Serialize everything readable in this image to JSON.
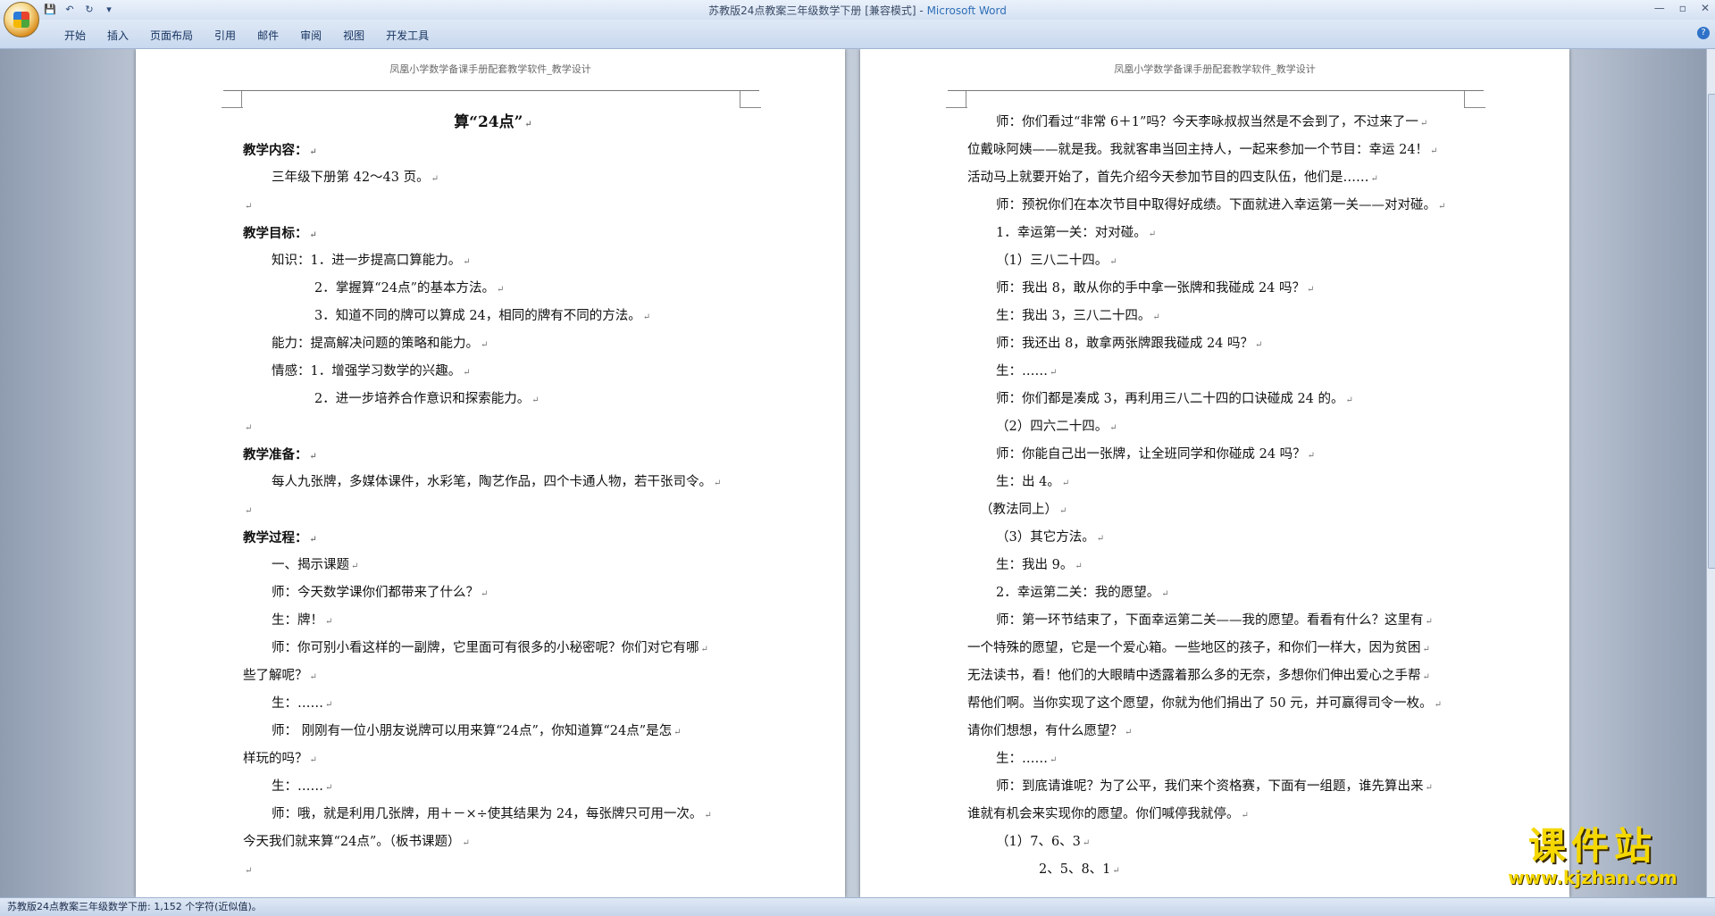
{
  "window": {
    "doc_title": "苏教版24点教案三年级数学下册 [兼容模式] - ",
    "app_name": "Microsoft Word",
    "controls": [
      "—",
      "▫",
      "✕"
    ]
  },
  "qat": {
    "save": "💾",
    "undo": "↶",
    "redo": "↻",
    "more": "▾"
  },
  "ribbon": {
    "tabs": [
      "开始",
      "插入",
      "页面布局",
      "引用",
      "邮件",
      "审阅",
      "视图",
      "开发工具"
    ],
    "help": "?"
  },
  "header_text": "凤凰小学数学备课手册配套教学软件_教学设计",
  "para_mark": "↵",
  "left_page": {
    "lines": [
      {
        "cls": "title",
        "text": "算“24点”"
      },
      {
        "cls": "heading",
        "text": "教学内容："
      },
      {
        "cls": "ind1",
        "text": "三年级下册第 42～43 页。"
      },
      {
        "cls": "",
        "text": ""
      },
      {
        "cls": "heading",
        "text": "教学目标："
      },
      {
        "cls": "ind1",
        "text": "知识：1．进一步提高口算能力。"
      },
      {
        "cls": "ind2",
        "text": "2．掌握算“24点”的基本方法。"
      },
      {
        "cls": "ind2",
        "text": "3．知道不同的牌可以算成 24，相同的牌有不同的方法。"
      },
      {
        "cls": "ind1",
        "text": "能力：提高解决问题的策略和能力。"
      },
      {
        "cls": "ind1",
        "text": "情感：1．增强学习数学的兴趣。"
      },
      {
        "cls": "ind2",
        "text": "2．进一步培养合作意识和探索能力。"
      },
      {
        "cls": "",
        "text": ""
      },
      {
        "cls": "heading",
        "text": "教学准备："
      },
      {
        "cls": "ind1",
        "text": "每人九张牌，多媒体课件，水彩笔，陶艺作品，四个卡通人物，若干张司令。"
      },
      {
        "cls": "",
        "text": ""
      },
      {
        "cls": "heading",
        "text": "教学过程："
      },
      {
        "cls": "ind1",
        "text": "一、揭示课题"
      },
      {
        "cls": "ind1",
        "text": "师：今天数学课你们都带来了什么？"
      },
      {
        "cls": "ind1",
        "text": "生：牌！"
      },
      {
        "cls": "ind1",
        "text": "师：你可别小看这样的一副牌，它里面可有很多的小秘密呢？你们对它有哪"
      },
      {
        "cls": "",
        "text": "些了解呢？"
      },
      {
        "cls": "ind1",
        "text": "生：……"
      },
      {
        "cls": "ind1",
        "text": "师：  刚刚有一位小朋友说牌可以用来算“24点”，你知道算“24点”是怎"
      },
      {
        "cls": "",
        "text": "样玩的吗？"
      },
      {
        "cls": "ind1",
        "text": "生：……"
      },
      {
        "cls": "ind1",
        "text": "师：哦，就是利用几张牌，用＋－×÷使其结果为 24，每张牌只可用一次。"
      },
      {
        "cls": "",
        "text": "今天我们就来算“24点”。（板书课题）"
      },
      {
        "cls": "",
        "text": ""
      }
    ]
  },
  "right_page": {
    "lines": [
      {
        "cls": "ind1",
        "text": "师：你们看过“非常 6＋1”吗？今天李咏叔叔当然是不会到了，不过来了一"
      },
      {
        "cls": "",
        "text": "位戴咏阿姨——就是我。我就客串当回主持人，一起来参加一个节目：幸运 24！"
      },
      {
        "cls": "",
        "text": "活动马上就要开始了，首先介绍今天参加节目的四支队伍，他们是……"
      },
      {
        "cls": "ind1",
        "text": "师：预祝你们在本次节目中取得好成绩。下面就进入幸运第一关——对对碰。"
      },
      {
        "cls": "ind1",
        "text": "1．幸运第一关：对对碰。"
      },
      {
        "cls": "ind1",
        "text": "（1）三八二十四。"
      },
      {
        "cls": "ind1",
        "text": "师：我出 8，敢从你的手中拿一张牌和我碰成 24 吗？"
      },
      {
        "cls": "ind1",
        "text": "生：我出 3，三八二十四。"
      },
      {
        "cls": "ind1",
        "text": "师：我还出 8，敢拿两张牌跟我碰成 24 吗？"
      },
      {
        "cls": "ind1",
        "text": "生：……"
      },
      {
        "cls": "ind1",
        "text": "师：你们都是凑成 3，再利用三八二十四的口诀碰成 24 的。"
      },
      {
        "cls": "ind1",
        "text": "（2）四六二十四。"
      },
      {
        "cls": "ind1",
        "text": "师：你能自己出一张牌，让全班同学和你碰成 24 吗？"
      },
      {
        "cls": "ind1",
        "text": "生：出 4。"
      },
      {
        "cls": "ind3",
        "text": "（教法同上）"
      },
      {
        "cls": "ind1",
        "text": "（3）其它方法。"
      },
      {
        "cls": "ind1",
        "text": "生：我出 9。"
      },
      {
        "cls": "ind1",
        "text": "2．幸运第二关：我的愿望。"
      },
      {
        "cls": "ind1",
        "text": "师：第一环节结束了，下面幸运第二关——我的愿望。看看有什么？这里有"
      },
      {
        "cls": "",
        "text": "一个特殊的愿望，它是一个爱心箱。一些地区的孩子，和你们一样大，因为贫困"
      },
      {
        "cls": "",
        "text": "无法读书，看！他们的大眼睛中透露着那么多的无奈，多想你们伸出爱心之手帮"
      },
      {
        "cls": "",
        "text": "帮他们啊。当你实现了这个愿望，你就为他们捐出了 50 元，并可赢得司令一枚。"
      },
      {
        "cls": "",
        "text": "请你们想想，有什么愿望？"
      },
      {
        "cls": "ind1",
        "text": "生：……"
      },
      {
        "cls": "ind1",
        "text": "师：到底请谁呢？为了公平，我们来个资格赛，下面有一组题，谁先算出来"
      },
      {
        "cls": "",
        "text": "谁就有机会来实现你的愿望。你们喊停我就停。"
      },
      {
        "cls": "ind1",
        "text": "（1）7、6、3"
      },
      {
        "cls": "ind2",
        "text": "2、5、8、1"
      }
    ]
  },
  "status": {
    "text": "苏教版24点教案三年级数学下册: 1,152 个字符(近似值)。"
  },
  "watermark": {
    "cn": "课件站",
    "url": "www.kjzhan.com"
  }
}
